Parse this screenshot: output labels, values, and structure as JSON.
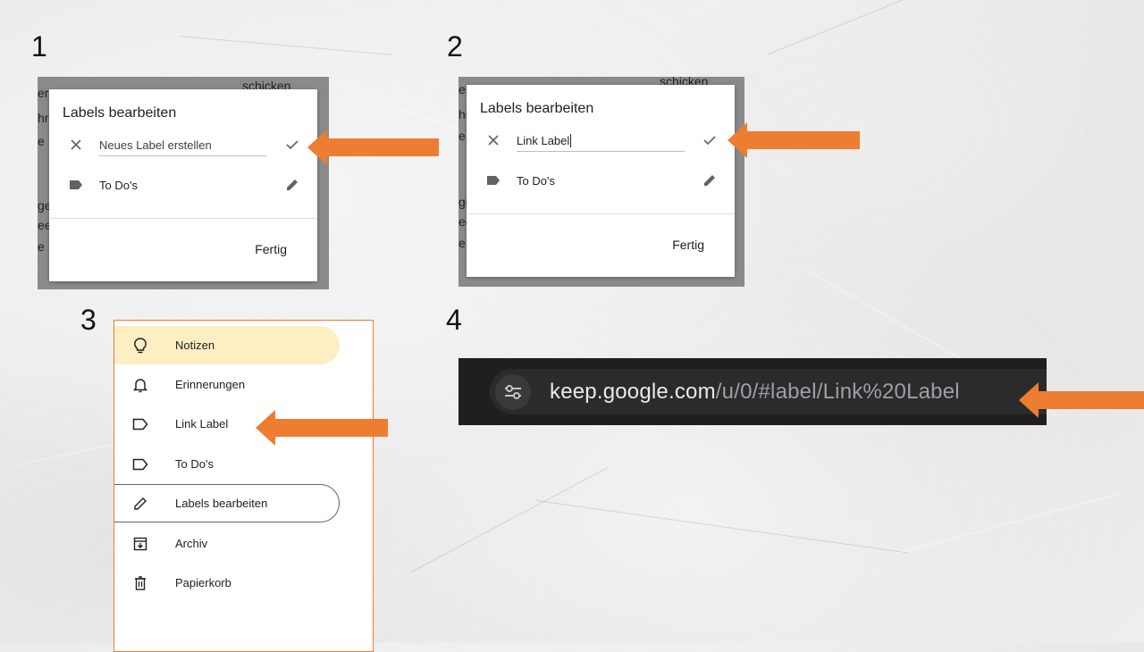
{
  "steps": [
    "1",
    "2",
    "3",
    "4"
  ],
  "dialog1": {
    "title": "Labels bearbeiten",
    "input_placeholder": "Neues Label erstellen",
    "label_item": "To Do's",
    "done_button": "Fertig",
    "background_text": [
      "schicken",
      "er",
      "hr",
      "e",
      "ge",
      "ee",
      "e"
    ]
  },
  "dialog2": {
    "title": "Labels bearbeiten",
    "input_value": "Link Label",
    "label_item": "To Do's",
    "done_button": "Fertig",
    "background_text": [
      "schicken",
      "er",
      "hr",
      "e",
      "ge",
      "ee",
      "e"
    ]
  },
  "sidebar": {
    "items": [
      {
        "label": "Notizen",
        "icon": "lightbulb-icon",
        "state": "active"
      },
      {
        "label": "Erinnerungen",
        "icon": "bell-icon"
      },
      {
        "label": "Link Label",
        "icon": "label-outline-icon"
      },
      {
        "label": "To Do's",
        "icon": "label-outline-icon"
      },
      {
        "label": "Labels bearbeiten",
        "icon": "pencil-icon",
        "state": "outlined"
      },
      {
        "label": "Archiv",
        "icon": "archive-icon"
      },
      {
        "label": "Papierkorb",
        "icon": "trash-icon"
      }
    ]
  },
  "address_bar": {
    "host": "keep.google.com",
    "path": "/u/0/#label/Link%20Label",
    "icon": "tune-icon"
  },
  "colors": {
    "arrow": "#ed7d31",
    "active_item": "#feefc3",
    "address_bar_bg": "#1f1f1f"
  }
}
